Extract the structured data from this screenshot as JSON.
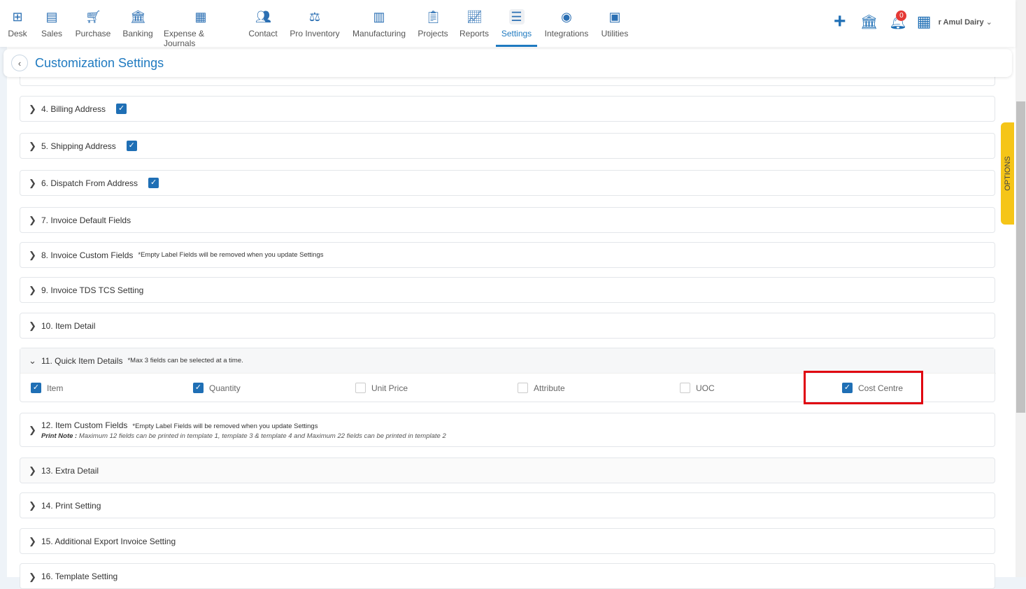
{
  "nav": {
    "items": [
      {
        "label": "Desk",
        "icon": "desk-grid-icon"
      },
      {
        "label": "Sales",
        "icon": "sales-receipt-icon"
      },
      {
        "label": "Purchase",
        "icon": "cart-icon"
      },
      {
        "label": "Banking",
        "icon": "bank-icon"
      },
      {
        "label": "Expense & Journals",
        "icon": "journal-icon"
      },
      {
        "label": "Contact",
        "icon": "contacts-icon"
      },
      {
        "label": "Pro Inventory",
        "icon": "inventory-trolley-icon"
      },
      {
        "label": "Manufacturing",
        "icon": "factory-icon"
      },
      {
        "label": "Projects",
        "icon": "projects-clipboard-icon"
      },
      {
        "label": "Reports",
        "icon": "report-chart-icon"
      },
      {
        "label": "Settings",
        "icon": "sliders-icon",
        "active": true
      },
      {
        "label": "Integrations",
        "icon": "plug-icon"
      },
      {
        "label": "Utilities",
        "icon": "utilities-icon"
      }
    ],
    "notification_count": "0",
    "company": "r Amul Dairy"
  },
  "header": {
    "title": "Customization Settings"
  },
  "sections": [
    {
      "label": "4. Billing Address",
      "checked": true
    },
    {
      "label": "5. Shipping Address",
      "checked": true
    },
    {
      "label": "6. Dispatch From Address",
      "checked": true
    },
    {
      "label": "7. Invoice Default Fields"
    },
    {
      "label": "8. Invoice Custom Fields",
      "note": "*Empty Label Fields will be removed when you update Settings"
    },
    {
      "label": "9. Invoice TDS TCS Setting"
    },
    {
      "label": "10. Item Detail"
    },
    {
      "label": "11. Quick Item Details",
      "note": "*Max 3 fields can be selected at a time.",
      "expanded": true,
      "options": [
        {
          "label": "Item",
          "checked": true
        },
        {
          "label": "Quantity",
          "checked": true
        },
        {
          "label": "Unit Price",
          "checked": false
        },
        {
          "label": "Attribute",
          "checked": false
        },
        {
          "label": "UOC",
          "checked": false
        },
        {
          "label": "Cost Centre",
          "checked": true,
          "highlighted": true
        }
      ]
    },
    {
      "label": "12. Item Custom Fields",
      "note": "*Empty Label Fields will be removed when you update Settings",
      "print_note_label": "Print Note :",
      "print_note": " Maximum 12 fields can be printed in template 1, template 3 & template 4 and Maximum 22 fields can be printed in template 2"
    },
    {
      "label": "13. Extra Detail"
    },
    {
      "label": "14. Print Setting"
    },
    {
      "label": "15. Additional Export Invoice Setting"
    },
    {
      "label": "16. Template Setting"
    }
  ],
  "side_tab": "OPTIONS",
  "colors": {
    "accent": "#1f7ac0",
    "checkbox": "#1f6fb5",
    "highlight": "#e0000f",
    "options_tab": "#f5c518"
  }
}
